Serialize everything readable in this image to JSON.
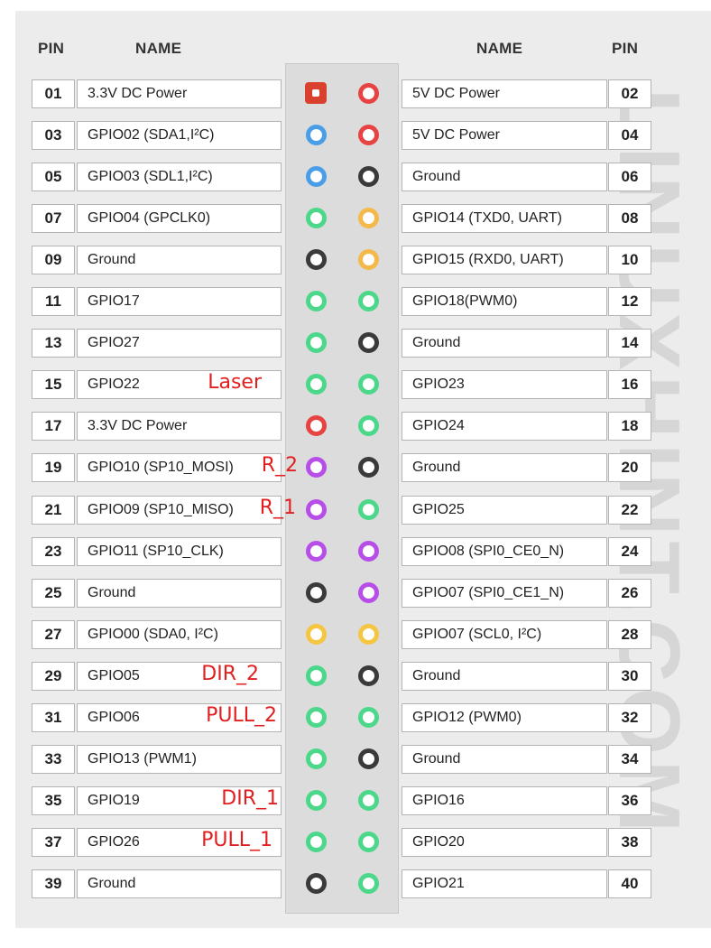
{
  "header": {
    "pin_left": "PIN",
    "name_left": "NAME",
    "name_right": "NAME",
    "pin_right": "PIN"
  },
  "watermark": "LINUXHINT.COM",
  "colors": {
    "power": "#e84343",
    "power_square": "#d9412e",
    "i2c": "#4a9ee8",
    "ground": "#3a3a3a",
    "gpio": "#4cd88a",
    "uart": "#f5b84a",
    "spi": "#b84ee8",
    "eeprom": "#f5c642"
  },
  "rows": [
    {
      "left_pin": "01",
      "left_name": "3.3V DC Power",
      "left_type": "power_square",
      "right_pin": "02",
      "right_name": "5V DC Power",
      "right_type": "power"
    },
    {
      "left_pin": "03",
      "left_name": "GPIO02 (SDA1,I²C)",
      "left_type": "i2c",
      "right_pin": "04",
      "right_name": "5V DC Power",
      "right_type": "power"
    },
    {
      "left_pin": "05",
      "left_name": "GPIO03 (SDL1,I²C)",
      "left_type": "i2c",
      "right_pin": "06",
      "right_name": "Ground",
      "right_type": "ground"
    },
    {
      "left_pin": "07",
      "left_name": "GPIO04 (GPCLK0)",
      "left_type": "gpio",
      "right_pin": "08",
      "right_name": "GPIO14 (TXD0, UART)",
      "right_type": "uart"
    },
    {
      "left_pin": "09",
      "left_name": "Ground",
      "left_type": "ground",
      "right_pin": "10",
      "right_name": "GPIO15 (RXD0, UART)",
      "right_type": "uart"
    },
    {
      "left_pin": "11",
      "left_name": "GPIO17",
      "left_type": "gpio",
      "right_pin": "12",
      "right_name": "GPIO18(PWM0)",
      "right_type": "gpio"
    },
    {
      "left_pin": "13",
      "left_name": "GPIO27",
      "left_type": "gpio",
      "right_pin": "14",
      "right_name": "Ground",
      "right_type": "ground"
    },
    {
      "left_pin": "15",
      "left_name": "GPIO22",
      "left_type": "gpio",
      "right_pin": "16",
      "right_name": "GPIO23",
      "right_type": "gpio",
      "note": "Laser"
    },
    {
      "left_pin": "17",
      "left_name": "3.3V DC Power",
      "left_type": "power",
      "right_pin": "18",
      "right_name": "GPIO24",
      "right_type": "gpio"
    },
    {
      "left_pin": "19",
      "left_name": "GPIO10 (SP10_MOSI)",
      "left_type": "spi",
      "right_pin": "20",
      "right_name": "Ground",
      "right_type": "ground",
      "note": "R_2"
    },
    {
      "left_pin": "21",
      "left_name": "GPIO09 (SP10_MISO)",
      "left_type": "spi",
      "right_pin": "22",
      "right_name": "GPIO25",
      "right_type": "gpio",
      "note": "R_1"
    },
    {
      "left_pin": "23",
      "left_name": "GPIO11 (SP10_CLK)",
      "left_type": "spi",
      "right_pin": "24",
      "right_name": "GPIO08 (SPI0_CE0_N)",
      "right_type": "spi"
    },
    {
      "left_pin": "25",
      "left_name": "Ground",
      "left_type": "ground",
      "right_pin": "26",
      "right_name": "GPIO07 (SPI0_CE1_N)",
      "right_type": "spi"
    },
    {
      "left_pin": "27",
      "left_name": "GPIO00 (SDA0, I²C)",
      "left_type": "eeprom",
      "right_pin": "28",
      "right_name": "GPIO07 (SCL0, I²C)",
      "right_type": "eeprom"
    },
    {
      "left_pin": "29",
      "left_name": "GPIO05",
      "left_type": "gpio",
      "right_pin": "30",
      "right_name": "Ground",
      "right_type": "ground",
      "note": "DIR_2"
    },
    {
      "left_pin": "31",
      "left_name": "GPIO06",
      "left_type": "gpio",
      "right_pin": "32",
      "right_name": "GPIO12 (PWM0)",
      "right_type": "gpio",
      "note": "PULL_2"
    },
    {
      "left_pin": "33",
      "left_name": "GPIO13 (PWM1)",
      "left_type": "gpio",
      "right_pin": "34",
      "right_name": "Ground",
      "right_type": "ground"
    },
    {
      "left_pin": "35",
      "left_name": "GPIO19",
      "left_type": "gpio",
      "right_pin": "36",
      "right_name": "GPIO16",
      "right_type": "gpio",
      "note": "DIR_1"
    },
    {
      "left_pin": "37",
      "left_name": "GPIO26",
      "left_type": "gpio",
      "right_pin": "38",
      "right_name": "GPIO20",
      "right_type": "gpio",
      "note": "PULL_1"
    },
    {
      "left_pin": "39",
      "left_name": "Ground",
      "left_type": "ground",
      "right_pin": "40",
      "right_name": "GPIO21",
      "right_type": "gpio"
    }
  ]
}
